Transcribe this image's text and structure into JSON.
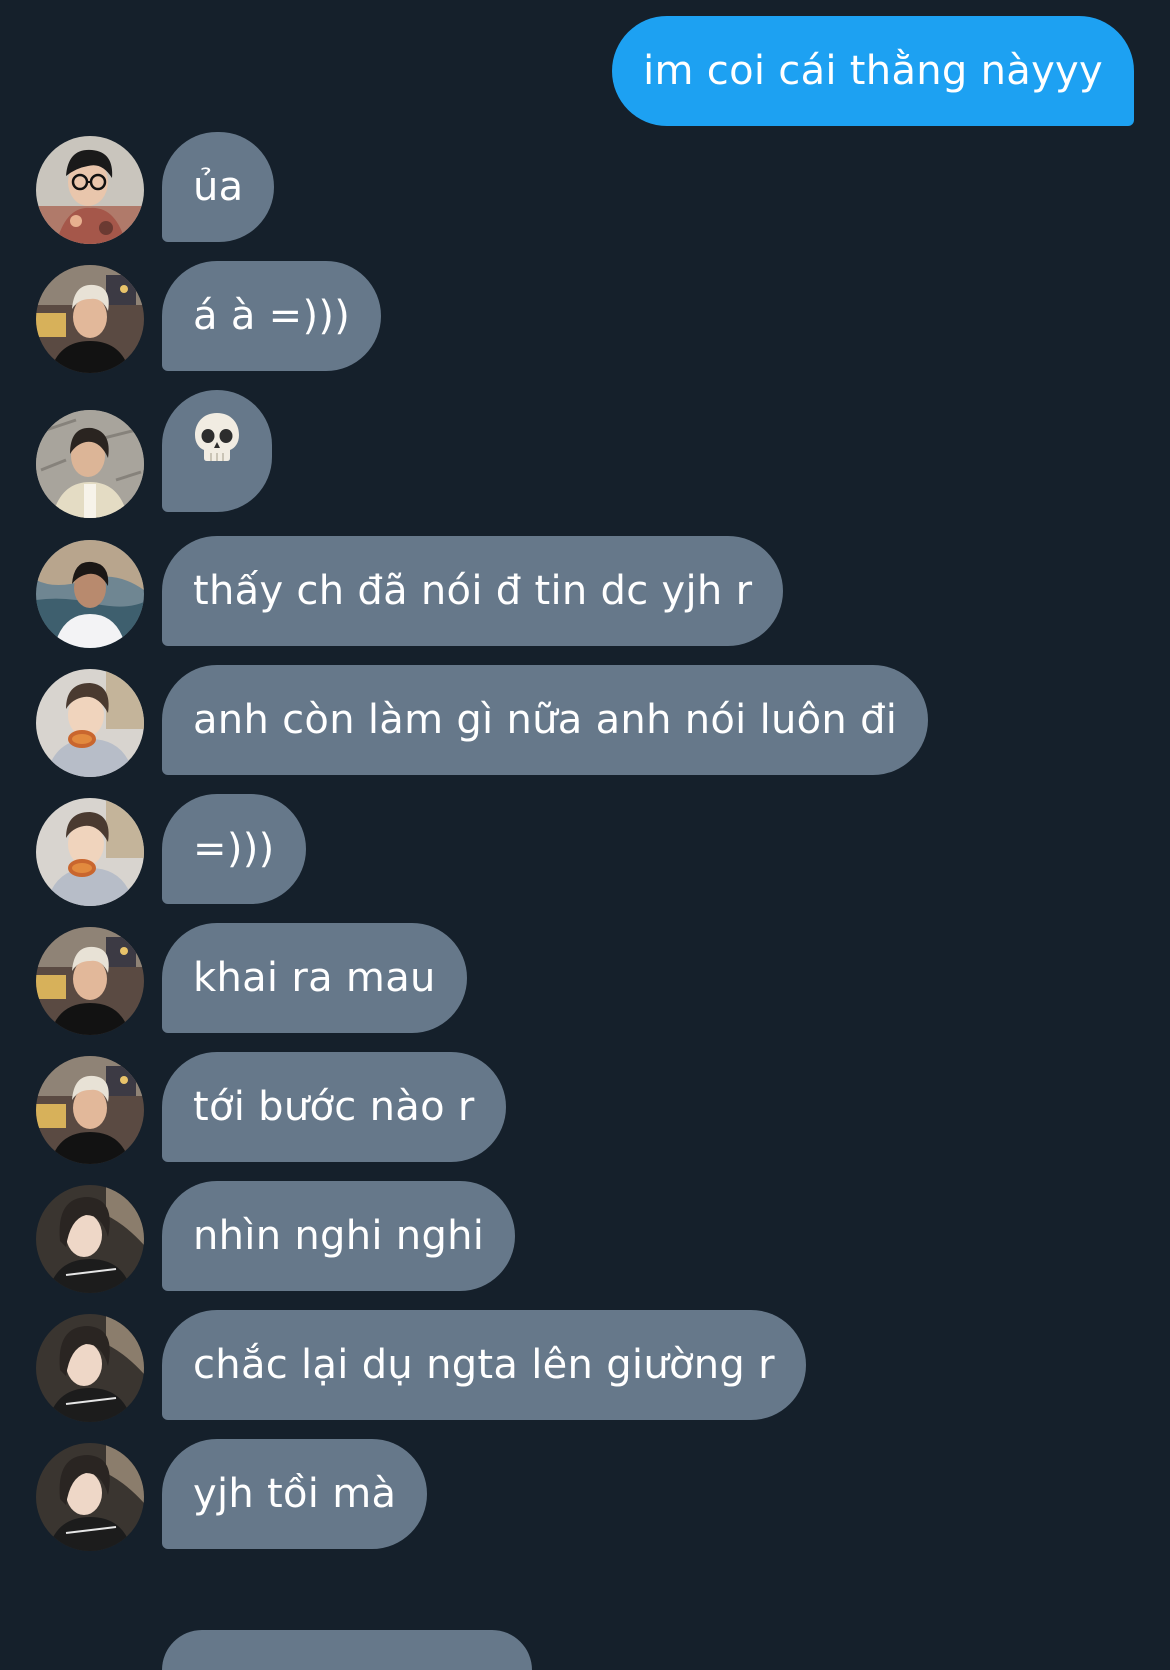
{
  "conversation": {
    "outgoing": [
      {
        "text": "im coi cái thằng nàyyy"
      }
    ],
    "incoming": [
      {
        "avatar": "avatar-glasses-floral",
        "text": "ủa"
      },
      {
        "avatar": "avatar-blond-street",
        "text": "á à =)))"
      },
      {
        "avatar": "avatar-cardigan-wall",
        "text": "",
        "emoji": "skull-icon"
      },
      {
        "avatar": "avatar-white-shirt-cliff",
        "text": "thấy ch đã nói đ tin dc yjh r"
      },
      {
        "avatar": "avatar-hoodie-eating",
        "text": "anh còn làm gì nữa anh nói luôn đi"
      },
      {
        "avatar": "avatar-hoodie-eating",
        "text": "=)))"
      },
      {
        "avatar": "avatar-blond-street",
        "text": "khai ra mau"
      },
      {
        "avatar": "avatar-blond-street",
        "text": "tới bước nào r"
      },
      {
        "avatar": "avatar-dark-hair-jersey",
        "text": "nhìn nghi nghi"
      },
      {
        "avatar": "avatar-dark-hair-jersey",
        "text": "chắc lại dụ ngta lên giường r"
      },
      {
        "avatar": "avatar-dark-hair-jersey",
        "text": "yjh tồi mà"
      }
    ]
  },
  "colors": {
    "background": "#15202b",
    "outgoing_bubble": "#1da1f2",
    "incoming_bubble": "#66788a",
    "text": "#ffffff"
  }
}
